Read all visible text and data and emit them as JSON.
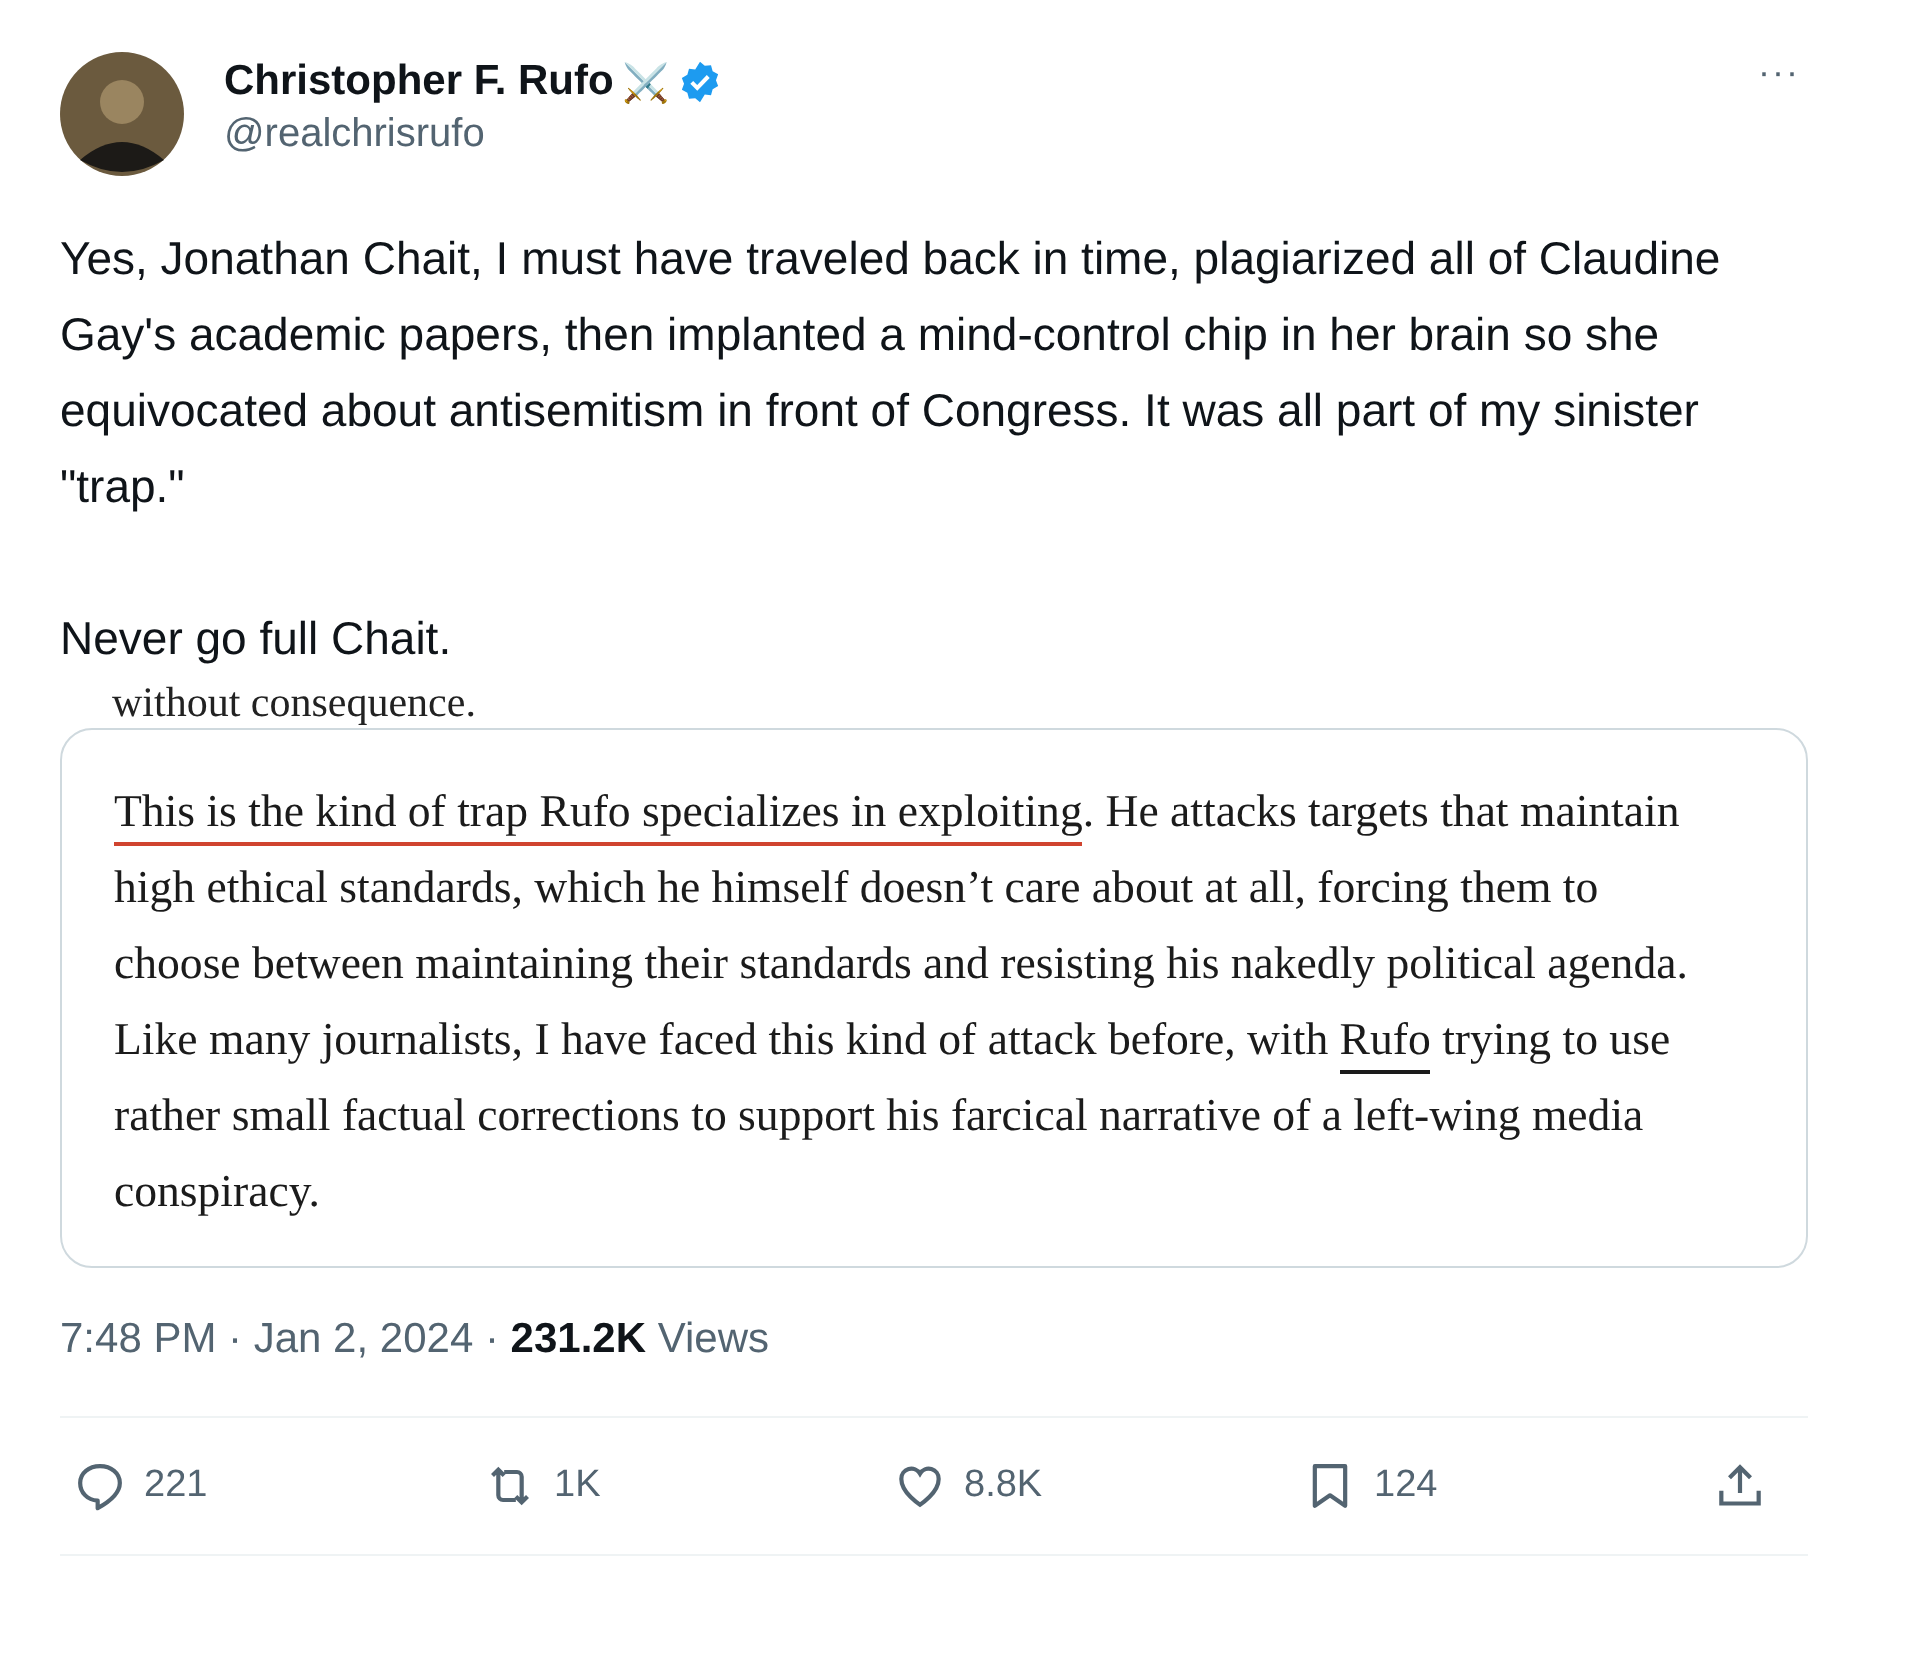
{
  "author": {
    "name": "Christopher F. Rufo",
    "emoji": "⚔️",
    "verified": true,
    "handle": "@realchrisrufo"
  },
  "more_button": "···",
  "text_paragraphs": [
    "Yes, Jonathan Chait, I must have traveled back in time, plagiarized all of Claudine Gay's academic papers, then implanted a mind-control chip in her brain so she equivocated about antisemitism in front of Congress. It was all part of my sinister \"trap.\"",
    "Never go full Chait."
  ],
  "attached_image": {
    "cut_line": "without consequence.",
    "segments": [
      {
        "text": "This is the kind of trap Rufo specializes in exploiting",
        "underlined": true,
        "color": "#d0442f"
      },
      {
        "text": ". He attacks targets that maintain high ethical standards, which he himself doesn’t care about at all, forcing them to choose between maintaining their standards and resisting his nakedly political agenda. Like many journalists, I have faced this kind of attack before, with ",
        "underlined": false
      },
      {
        "text": "Rufo",
        "underlined": true,
        "color": "#1b1b1b"
      },
      {
        "text": " trying to use rather small factual corrections to support his farcical narrative of a left-wing media conspiracy.",
        "underlined": false
      }
    ]
  },
  "meta": {
    "time": "7:48 PM · Jan 2, 2024 · ",
    "views_count": "231.2K",
    "views_label": " Views"
  },
  "actions": [
    {
      "kind": "reply",
      "count": "221"
    },
    {
      "kind": "repost",
      "count": "1K"
    },
    {
      "kind": "like",
      "count": "8.8K"
    },
    {
      "kind": "bookmark",
      "count": "124"
    },
    {
      "kind": "share"
    }
  ]
}
